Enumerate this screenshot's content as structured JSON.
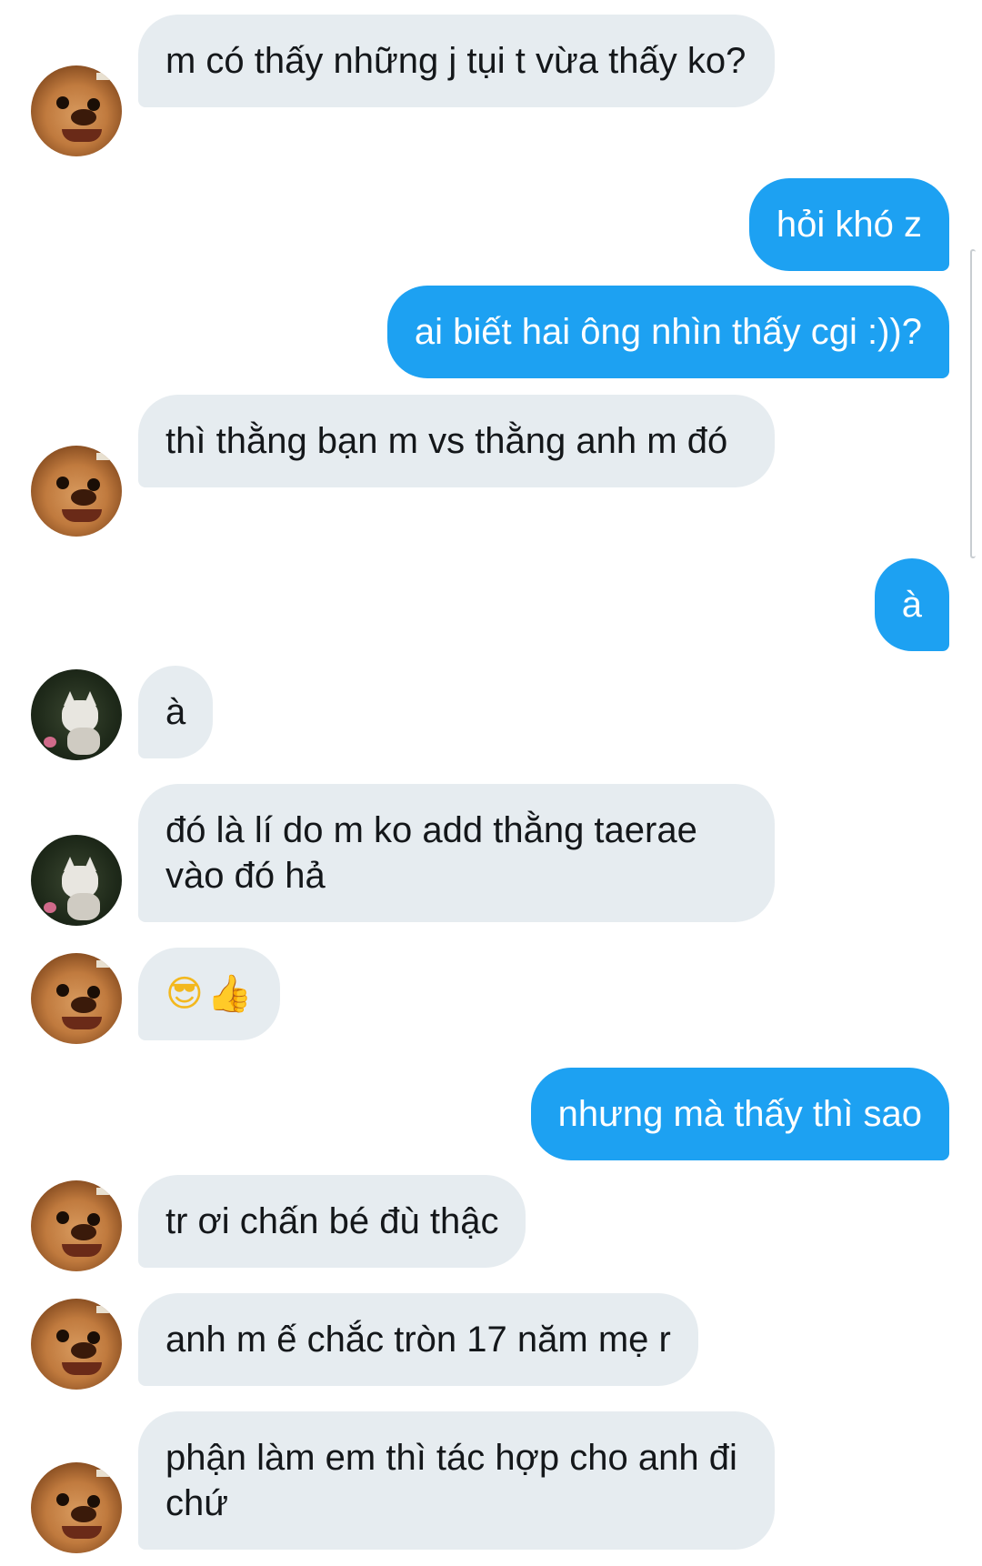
{
  "messages": [
    {
      "id": "m1",
      "direction": "incoming",
      "avatar": "dog-avatar",
      "text": "m có thấy những j tụi t vừa thấy ko?"
    },
    {
      "id": "m2",
      "direction": "outgoing",
      "text": "hỏi khó z"
    },
    {
      "id": "m3",
      "direction": "outgoing",
      "text": "ai biết hai ông nhìn thấy cgi :))?"
    },
    {
      "id": "m4",
      "direction": "incoming",
      "avatar": "dog-avatar",
      "text": "thì thằng bạn m vs thằng anh m đó"
    },
    {
      "id": "m5",
      "direction": "outgoing",
      "text": "à"
    },
    {
      "id": "m6",
      "direction": "incoming",
      "avatar": "cat-avatar",
      "text": "à"
    },
    {
      "id": "m7",
      "direction": "incoming",
      "avatar": "cat-avatar",
      "text": "đó là lí do m ko add thằng taerae vào đó hả"
    },
    {
      "id": "m8",
      "direction": "incoming",
      "avatar": "dog-avatar",
      "emojis": [
        "😎",
        "👍"
      ]
    },
    {
      "id": "m9",
      "direction": "outgoing",
      "text": "nhưng mà thấy thì sao"
    },
    {
      "id": "m10",
      "direction": "incoming",
      "avatar": "dog-avatar",
      "text": "tr ơi chấn bé đù thậc"
    },
    {
      "id": "m11",
      "direction": "incoming",
      "avatar": "dog-avatar",
      "text": "anh m ế chắc tròn 17 năm mẹ r"
    },
    {
      "id": "m12",
      "direction": "incoming",
      "avatar": "dog-avatar",
      "text": "phận làm em thì tác hợp cho anh đi chứ"
    }
  ],
  "colors": {
    "incoming_bubble": "#e6ecf0",
    "incoming_text": "#14171a",
    "outgoing_bubble": "#1da1f2",
    "outgoing_text": "#ffffff"
  },
  "icons": {
    "emoji_cool": "smiling-face-with-sunglasses-icon",
    "emoji_thumb": "thumbs-up-icon"
  }
}
